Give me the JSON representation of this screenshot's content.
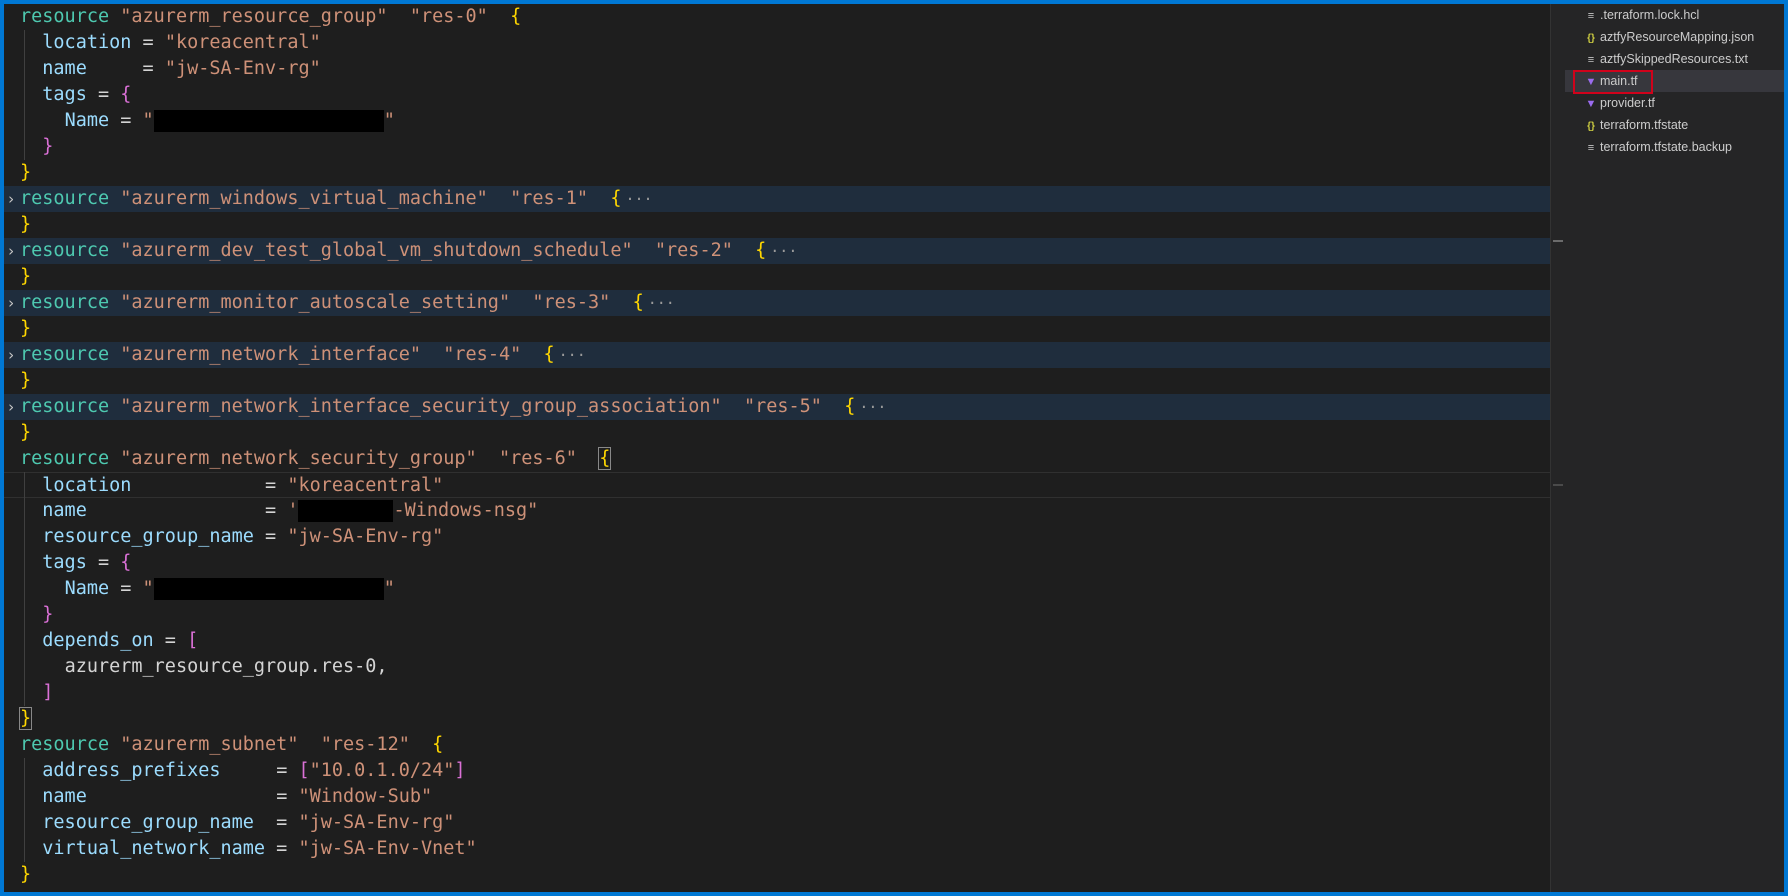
{
  "editor": {
    "lines": [
      {
        "code": [
          [
            "kw",
            "resource "
          ],
          [
            "str",
            "\"azurerm_resource_group\""
          ],
          [
            "",
            "  "
          ],
          [
            "str",
            "\"res-0\""
          ],
          [
            "",
            "  "
          ],
          [
            "b1",
            "{"
          ]
        ]
      },
      {
        "code": [
          [
            "",
            "  "
          ],
          [
            "prop",
            "location"
          ],
          [
            "",
            " = "
          ],
          [
            "str",
            "\"koreacentral\""
          ]
        ]
      },
      {
        "code": [
          [
            "",
            "  "
          ],
          [
            "prop",
            "name"
          ],
          [
            "",
            "     = "
          ],
          [
            "str",
            "\"jw-SA-Env-rg\""
          ]
        ]
      },
      {
        "code": [
          [
            "",
            "  "
          ],
          [
            "prop",
            "tags"
          ],
          [
            "",
            " = "
          ],
          [
            "b2",
            "{"
          ]
        ]
      },
      {
        "code": [
          [
            "",
            "    "
          ],
          [
            "prop",
            "Name"
          ],
          [
            "",
            " = "
          ],
          [
            "str",
            "\""
          ],
          [
            "redact",
            "230"
          ],
          [
            "str",
            "\""
          ]
        ]
      },
      {
        "code": [
          [
            "",
            "  "
          ],
          [
            "b2",
            "}"
          ]
        ]
      },
      {
        "code": [
          [
            "b1",
            "}"
          ]
        ]
      },
      {
        "folded": true,
        "code": [
          [
            "kw",
            "resource "
          ],
          [
            "str",
            "\"azurerm_windows_virtual_machine\""
          ],
          [
            "",
            "  "
          ],
          [
            "str",
            "\"res-1\""
          ],
          [
            "",
            "  "
          ],
          [
            "b1",
            "{"
          ],
          [
            "ell",
            "···"
          ]
        ]
      },
      {
        "code": [
          [
            "b1",
            "}"
          ]
        ]
      },
      {
        "folded": true,
        "code": [
          [
            "kw",
            "resource "
          ],
          [
            "str",
            "\"azurerm_dev_test_global_vm_shutdown_schedule\""
          ],
          [
            "",
            "  "
          ],
          [
            "str",
            "\"res-2\""
          ],
          [
            "",
            "  "
          ],
          [
            "b1",
            "{"
          ],
          [
            "ell",
            "···"
          ]
        ]
      },
      {
        "code": [
          [
            "b1",
            "}"
          ]
        ]
      },
      {
        "folded": true,
        "code": [
          [
            "kw",
            "resource "
          ],
          [
            "str",
            "\"azurerm_monitor_autoscale_setting\""
          ],
          [
            "",
            "  "
          ],
          [
            "str",
            "\"res-3\""
          ],
          [
            "",
            "  "
          ],
          [
            "b1",
            "{"
          ],
          [
            "ell",
            "···"
          ]
        ]
      },
      {
        "code": [
          [
            "b1",
            "}"
          ]
        ]
      },
      {
        "folded": true,
        "code": [
          [
            "kw",
            "resource "
          ],
          [
            "str",
            "\"azurerm_network_interface\""
          ],
          [
            "",
            "  "
          ],
          [
            "str",
            "\"res-4\""
          ],
          [
            "",
            "  "
          ],
          [
            "b1",
            "{"
          ],
          [
            "ell",
            "···"
          ]
        ]
      },
      {
        "code": [
          [
            "b1",
            "}"
          ]
        ]
      },
      {
        "folded": true,
        "code": [
          [
            "kw",
            "resource "
          ],
          [
            "str",
            "\"azurerm_network_interface_security_group_association\""
          ],
          [
            "",
            "  "
          ],
          [
            "str",
            "\"res-5\""
          ],
          [
            "",
            "  "
          ],
          [
            "b1",
            "{"
          ],
          [
            "ell",
            "···"
          ]
        ]
      },
      {
        "code": [
          [
            "b1",
            "}"
          ]
        ]
      },
      {
        "code": [
          [
            "kw",
            "resource "
          ],
          [
            "str",
            "\"azurerm_network_security_group\""
          ],
          [
            "",
            "  "
          ],
          [
            "str",
            "\"res-6\""
          ],
          [
            "",
            "  "
          ],
          [
            "b1box",
            "{"
          ]
        ]
      },
      {
        "current": true,
        "code": [
          [
            "",
            "  "
          ],
          [
            "prop",
            "location"
          ],
          [
            "",
            "            = "
          ],
          [
            "str",
            "\"koreacentral\""
          ]
        ]
      },
      {
        "code": [
          [
            "",
            "  "
          ],
          [
            "prop",
            "name"
          ],
          [
            "",
            "                = "
          ],
          [
            "str",
            "'"
          ],
          [
            "redact",
            "95"
          ],
          [
            "str",
            "-Windows-nsg\""
          ]
        ]
      },
      {
        "code": [
          [
            "",
            "  "
          ],
          [
            "prop",
            "resource_group_name"
          ],
          [
            "",
            " = "
          ],
          [
            "str",
            "\"jw-SA-Env-rg\""
          ]
        ]
      },
      {
        "code": [
          [
            "",
            "  "
          ],
          [
            "prop",
            "tags"
          ],
          [
            "",
            " = "
          ],
          [
            "b2",
            "{"
          ]
        ]
      },
      {
        "code": [
          [
            "",
            "    "
          ],
          [
            "prop",
            "Name"
          ],
          [
            "",
            " = "
          ],
          [
            "str",
            "\""
          ],
          [
            "redact",
            "230"
          ],
          [
            "str",
            "\""
          ]
        ]
      },
      {
        "code": [
          [
            "",
            "  "
          ],
          [
            "b2",
            "}"
          ]
        ]
      },
      {
        "code": [
          [
            "",
            "  "
          ],
          [
            "prop",
            "depends_on"
          ],
          [
            "",
            " = "
          ],
          [
            "b2",
            "["
          ]
        ]
      },
      {
        "code": [
          [
            "",
            "    "
          ],
          [
            "",
            "azurerm_resource_group.res-0,"
          ]
        ]
      },
      {
        "code": [
          [
            "",
            "  "
          ],
          [
            "b2",
            "]"
          ]
        ]
      },
      {
        "code": [
          [
            "b1box",
            "}"
          ]
        ]
      },
      {
        "code": [
          [
            "kw",
            "resource "
          ],
          [
            "str",
            "\"azurerm_subnet\""
          ],
          [
            "",
            "  "
          ],
          [
            "str",
            "\"res-12\""
          ],
          [
            "",
            "  "
          ],
          [
            "b1",
            "{"
          ]
        ]
      },
      {
        "code": [
          [
            "",
            "  "
          ],
          [
            "prop",
            "address_prefixes"
          ],
          [
            "",
            "     = "
          ],
          [
            "b2",
            "["
          ],
          [
            "str",
            "\"10.0.1.0/24\""
          ],
          [
            "b2",
            "]"
          ]
        ]
      },
      {
        "code": [
          [
            "",
            "  "
          ],
          [
            "prop",
            "name"
          ],
          [
            "",
            "                 = "
          ],
          [
            "str",
            "\"Window-Sub\""
          ]
        ]
      },
      {
        "code": [
          [
            "",
            "  "
          ],
          [
            "prop",
            "resource_group_name"
          ],
          [
            "",
            "  = "
          ],
          [
            "str",
            "\"jw-SA-Env-rg\""
          ]
        ]
      },
      {
        "code": [
          [
            "",
            "  "
          ],
          [
            "prop",
            "virtual_network_name"
          ],
          [
            "",
            " = "
          ],
          [
            "str",
            "\"jw-SA-Env-Vnet\""
          ]
        ]
      },
      {
        "code": [
          [
            "b1",
            "}"
          ]
        ]
      }
    ]
  },
  "explorer": {
    "files": [
      {
        "name": ".terraform.lock.hcl",
        "icon": "lines-icon"
      },
      {
        "name": "aztfyResourceMapping.json",
        "icon": "json-icon"
      },
      {
        "name": "aztfySkippedResources.txt",
        "icon": "lines-icon"
      },
      {
        "name": "main.tf",
        "icon": "terraform-icon",
        "selected": true
      },
      {
        "name": "provider.tf",
        "icon": "terraform-icon"
      },
      {
        "name": "terraform.tfstate",
        "icon": "json-icon"
      },
      {
        "name": "terraform.tfstate.backup",
        "icon": "lines-icon"
      }
    ]
  },
  "colors": {
    "keyword": "#4ec9b0",
    "string": "#ce9178",
    "property": "#9cdcfe",
    "bracket_1": "#ffd700",
    "bracket_2": "#da70d6",
    "selection_outline": "#d0021b",
    "window_border": "#0078d4"
  }
}
